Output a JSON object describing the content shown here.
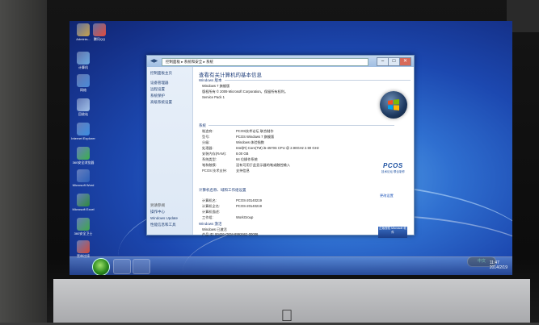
{
  "desktop": {
    "icons": [
      {
        "label": "Adminis...",
        "color": "#c8a24a"
      },
      {
        "label": "腾讯QQ",
        "color": "#e34a3a"
      },
      {
        "label": "计算机",
        "color": "#6aa8e0"
      },
      {
        "label": "网络",
        "color": "#4a8ad8"
      },
      {
        "label": "回收站",
        "color": "#a0c0e8"
      },
      {
        "label": "Internet Explorer",
        "color": "#3b8de0"
      },
      {
        "label": "360安全浏览器",
        "color": "#3cb04a"
      },
      {
        "label": "Microsoft Word",
        "color": "#2b5fb8"
      },
      {
        "label": "Microsoft Excel",
        "color": "#2f8a3c"
      },
      {
        "label": "360安全卫士",
        "color": "#3fa84a"
      },
      {
        "label": "宽带连接",
        "color": "#d04a3a"
      }
    ]
  },
  "window": {
    "address": "控制面板 ▸ 系统和安全 ▸ 系统",
    "controls": {
      "minimize": "–",
      "maximize": "□",
      "close": "✕"
    },
    "nav_back": "◀▶",
    "sidebar": {
      "home": "控制面板主页",
      "links": [
        "设备管理器",
        "远程设置",
        "系统保护",
        "高级系统设置"
      ],
      "see_also_title": "另请参阅",
      "see_also": [
        "操作中心",
        "Windows Update",
        "性能信息和工具"
      ]
    },
    "title": "查看有关计算机的基本信息",
    "edition_header": "Windows 版本",
    "edition": "Windows 7 旗舰版",
    "copyright": "版权所有 © 2009 Microsoft Corporation。保留所有权利。",
    "service_pack": "Service Pack 1",
    "system_header": "系统",
    "system_rows": [
      {
        "k": "制造商:",
        "v": "PCOS技术论坛 联合制作"
      },
      {
        "k": "型号:",
        "v": "PCOS Windows 7 旗舰版"
      },
      {
        "k": "分级:",
        "v": "Windows 体验指数"
      },
      {
        "k": "处理器:",
        "v": "Intel(R) Core(TM) i5-4570S CPU @ 2.90GHz  2.90 GHz"
      },
      {
        "k": "安装内存(RAM):",
        "v": "8.00 GB"
      },
      {
        "k": "系统类型:",
        "v": "64 位操作系统"
      },
      {
        "k": "笔和触摸:",
        "v": "没有可用于此显示器的笔或触控输入"
      },
      {
        "k": "PCOS 技术支持:",
        "v": "支持信息"
      }
    ],
    "pcos": "PCOS",
    "pcos_sub": "技术论坛 联合制作",
    "computer_header": "计算机名称、域和工作组设置",
    "change_settings": "更改设置",
    "computer_rows": [
      {
        "k": "计算机名:",
        "v": "PCOS-20140219"
      },
      {
        "k": "计算机全名:",
        "v": "PCOS-20140219"
      },
      {
        "k": "计算机描述:",
        "v": ""
      },
      {
        "k": "工作组:",
        "v": "WorkGroup"
      }
    ],
    "activation_header": "Windows 激活",
    "activation": "Windows 已激活",
    "product_id": "产品 ID: 00426-OEM-8992662-00006",
    "genuine": "正版授权 Microsoft 软件"
  },
  "taskbar": {
    "tray_time": "11:47",
    "tray_date": "2014/2/19",
    "ime": "中文"
  }
}
